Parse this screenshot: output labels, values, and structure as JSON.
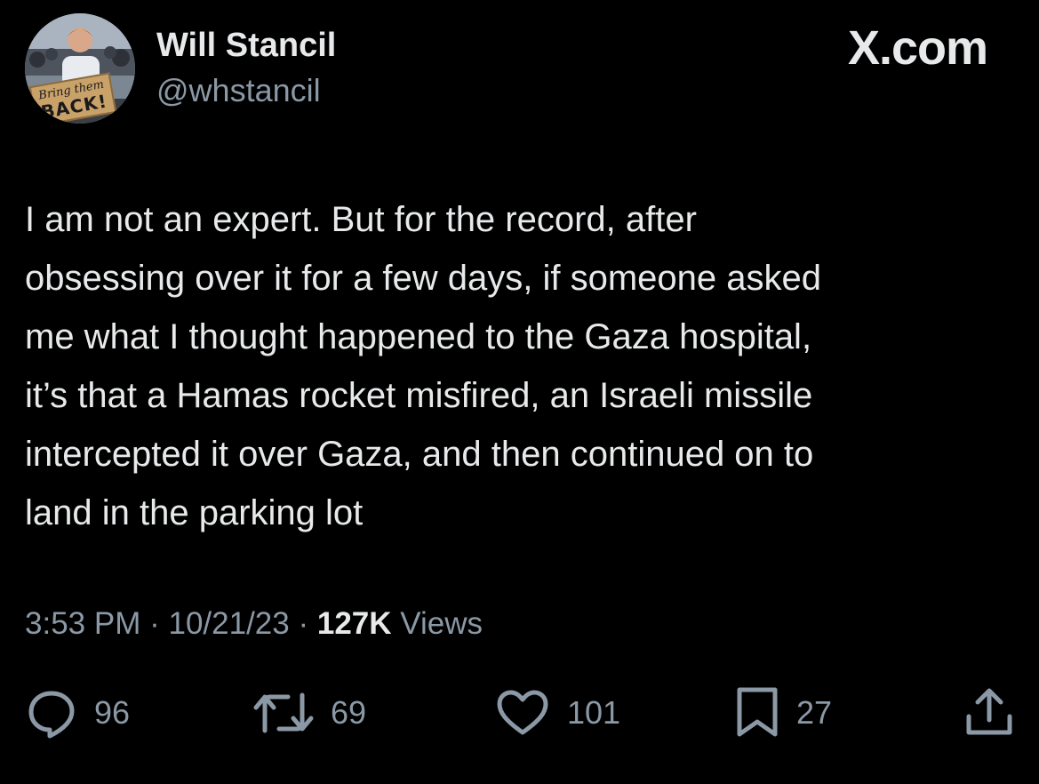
{
  "author": {
    "display_name": "Will Stancil",
    "handle": "@whstancil",
    "avatar_sign_line1": "Bring them",
    "avatar_sign_line2": "BACK!"
  },
  "brand": {
    "site": "X.com"
  },
  "tweet": {
    "text": "I am not an expert. But for the record, after\nobsessing over it for a few days, if someone asked\nme what I thought happened to the Gaza hospital,\nit’s that a Hamas rocket misfired, an Israeli missile\nintercepted it over Gaza, and then continued on to\nland in the parking lot",
    "time": "3:53 PM",
    "date": "10/21/23",
    "separator": "·",
    "views_count": "127K",
    "views_label": "Views"
  },
  "actions": {
    "reply_count": "96",
    "repost_count": "69",
    "like_count": "101",
    "bookmark_count": "27"
  },
  "icons": {
    "reply": "reply-icon",
    "repost": "repost-icon",
    "like": "heart-icon",
    "bookmark": "bookmark-icon",
    "share": "share-icon"
  },
  "colors": {
    "background": "#000000",
    "primary_text": "#e7e9ea",
    "secondary_text": "#8b98a5"
  }
}
